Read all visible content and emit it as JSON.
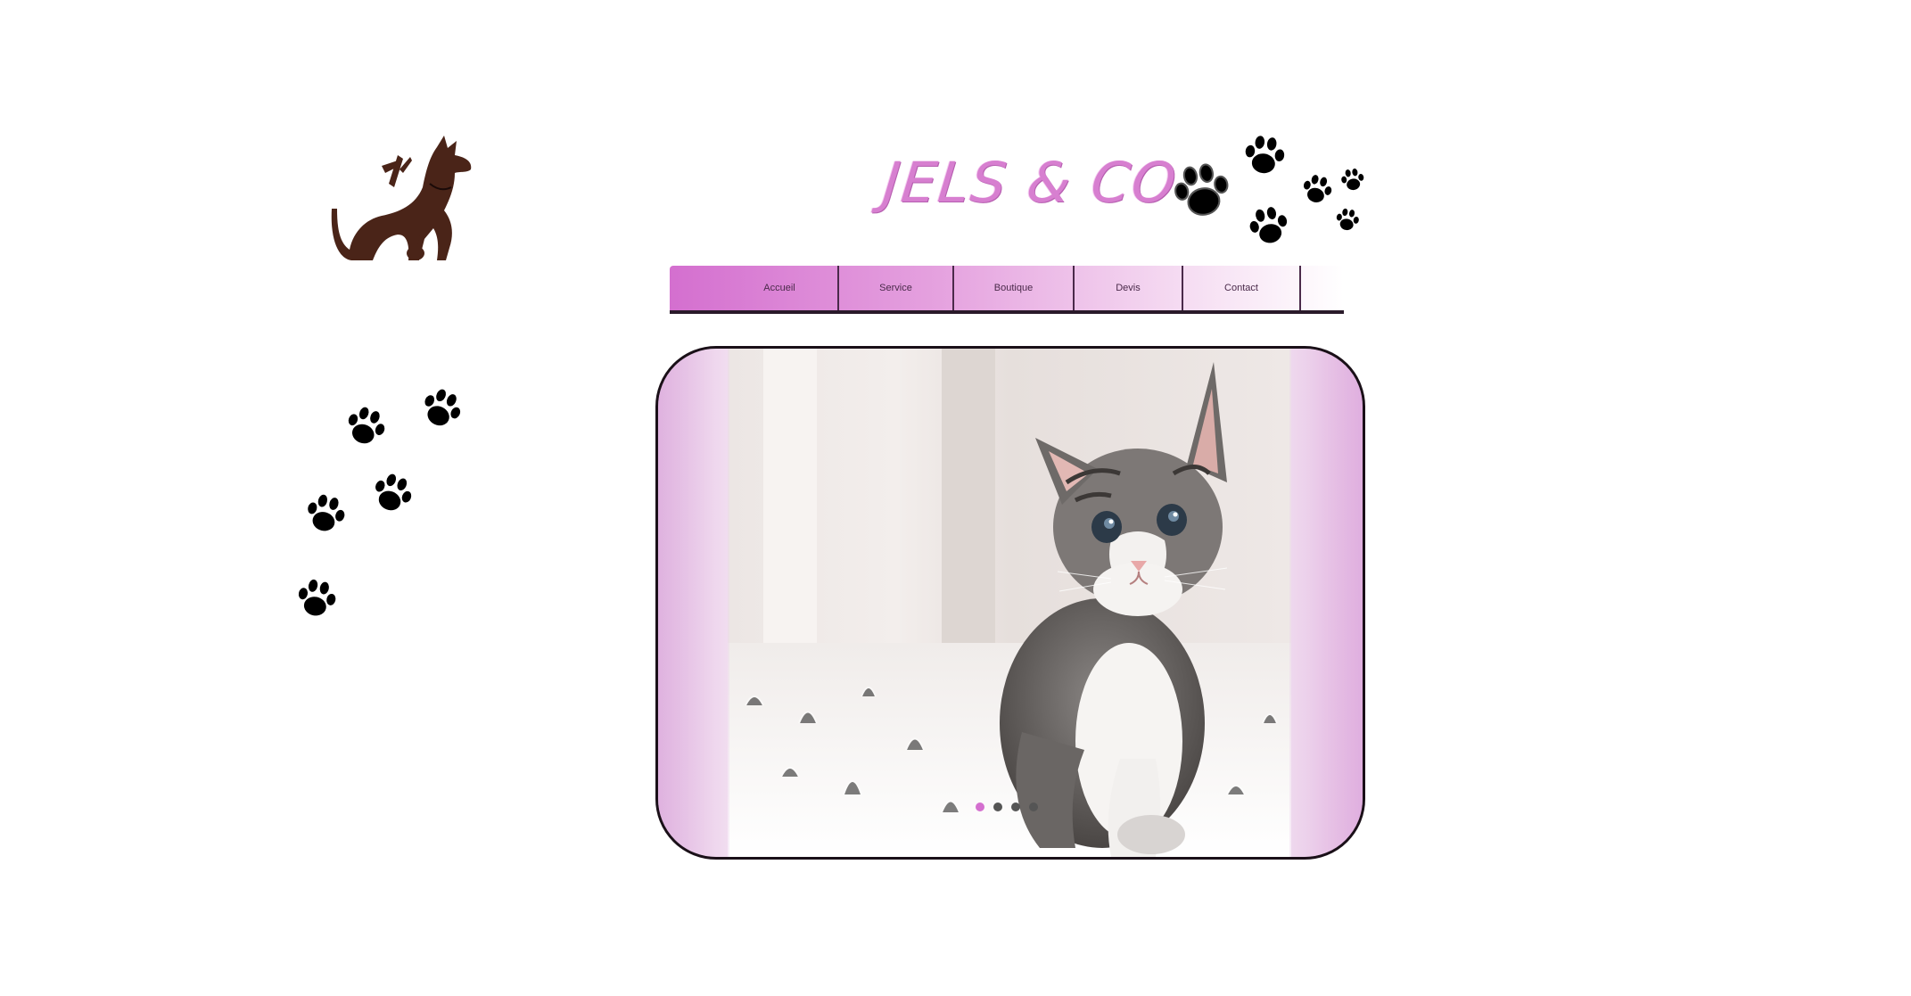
{
  "brand": {
    "title": "JELS & CO"
  },
  "nav": {
    "items": [
      {
        "label": "Accueil"
      },
      {
        "label": "Service"
      },
      {
        "label": "Boutique"
      },
      {
        "label": "Devis"
      },
      {
        "label": "Contact"
      }
    ]
  },
  "slider": {
    "slide_count": 4,
    "active_slide": 1
  },
  "colors": {
    "accent": "#d46fcf",
    "brand_text": "#d77fd0",
    "logo": "#4a2418",
    "paw": "#000000"
  }
}
